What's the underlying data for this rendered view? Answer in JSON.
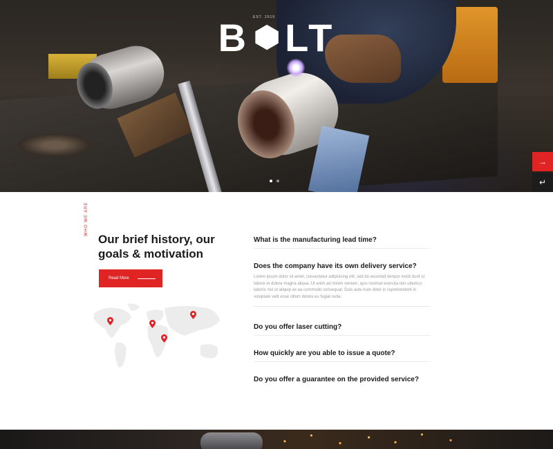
{
  "hero": {
    "logo_left": "B",
    "logo_right": "LT",
    "logo_tag": "EST. 2019",
    "slides": 2,
    "active_slide": 1,
    "side_buttons": {
      "red": "→",
      "dark": "↵"
    }
  },
  "about": {
    "vertical_tag": "WHO WE ARE",
    "title": "Our brief history, our goals & motivation",
    "read_more_label": "Read More",
    "map_pins": 4
  },
  "faq": {
    "items": [
      {
        "question": "What is the manufacturing lead time?",
        "answer": ""
      },
      {
        "question": "Does the company have its own delivery service?",
        "answer": "Lorem ipsum dolor sit amet, consectetur adipisicing elit, sed do eiusmod tempor incidi dunt ut labore et dolore magna aliqua. Ut enim ad minim veniam, quis nostrud exercita tion ullamco laboris nisi ut aliquip ex ea commodo consequat. Duis aute irure dolor in reprehenderit in voluptate velit esse cillum dolore eu fugiat nulla."
      },
      {
        "question": "Do you offer laser cutting?",
        "answer": ""
      },
      {
        "question": "How quickly are you able to issue a quote?",
        "answer": ""
      },
      {
        "question": "Do you offer a guarantee on the provided service?",
        "answer": ""
      }
    ]
  },
  "colors": {
    "accent": "#e02424",
    "text": "#1b1b1b",
    "muted": "#9a9a9a"
  }
}
